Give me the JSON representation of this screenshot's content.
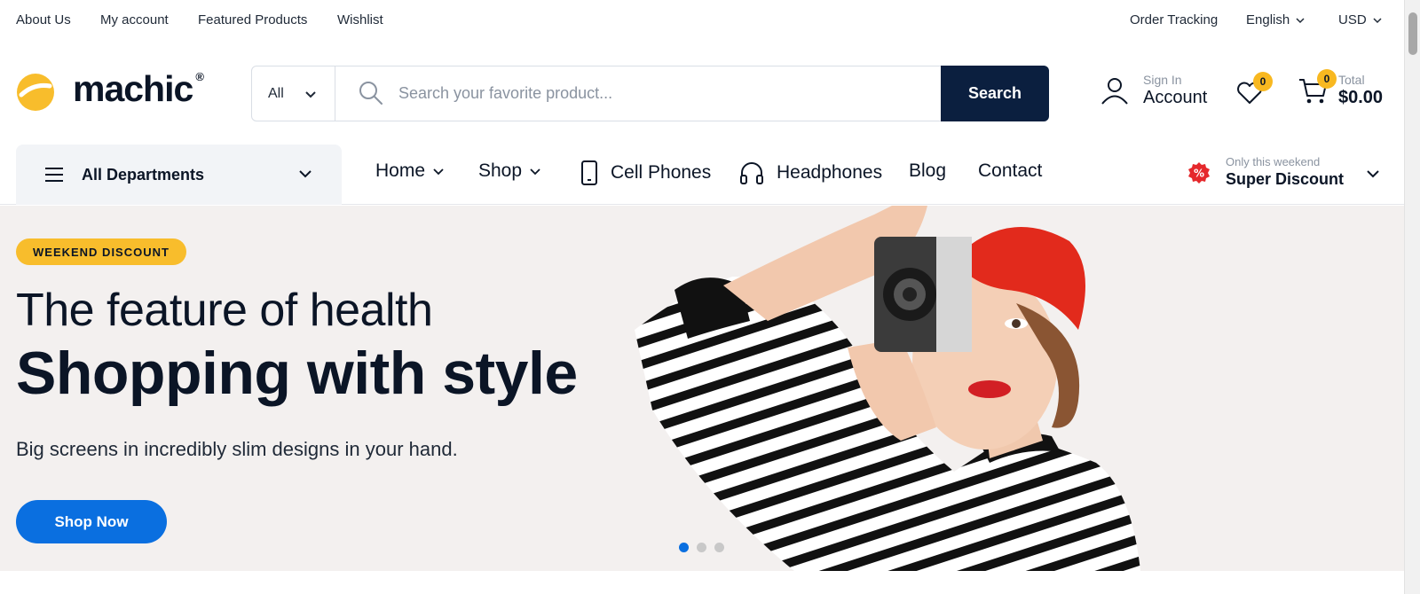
{
  "topbar": {
    "left_links": [
      "About Us",
      "My account",
      "Featured Products",
      "Wishlist"
    ],
    "order_tracking": "Order Tracking",
    "language": "English",
    "currency": "USD"
  },
  "brand": {
    "name": "machic",
    "registered": "®",
    "accent_color": "#f8bd2c"
  },
  "search": {
    "category": "All",
    "placeholder": "Search your favorite product...",
    "value": "",
    "button_label": "Search",
    "button_color": "#0b1f3f"
  },
  "account": {
    "sign_in_label": "Sign In",
    "account_label": "Account"
  },
  "wishlist": {
    "count": "0"
  },
  "cart": {
    "count": "0",
    "total_label": "Total",
    "total_value": "$0.00"
  },
  "nav": {
    "departments_label": "All Departments",
    "items": [
      "Home",
      "Shop",
      "Cell Phones",
      "Headphones",
      "Blog",
      "Contact"
    ],
    "discount_small": "Only this weekend",
    "discount_big": "Super Discount",
    "discount_icon_color": "#e5282c"
  },
  "hero": {
    "badge": "WEEKEND DISCOUNT",
    "subtitle": "The feature of health",
    "title": "Shopping with style",
    "description": "Big screens in incredibly slim designs in your hand.",
    "button_label": "Shop Now",
    "button_color": "#0a6fe0",
    "slides_total": 3,
    "active_slide": 1
  },
  "icons": [
    "chevron-down-icon",
    "search-icon",
    "user-icon",
    "heart-icon",
    "cart-icon",
    "menu-icon",
    "phone-icon",
    "headphones-icon",
    "discount-icon"
  ]
}
